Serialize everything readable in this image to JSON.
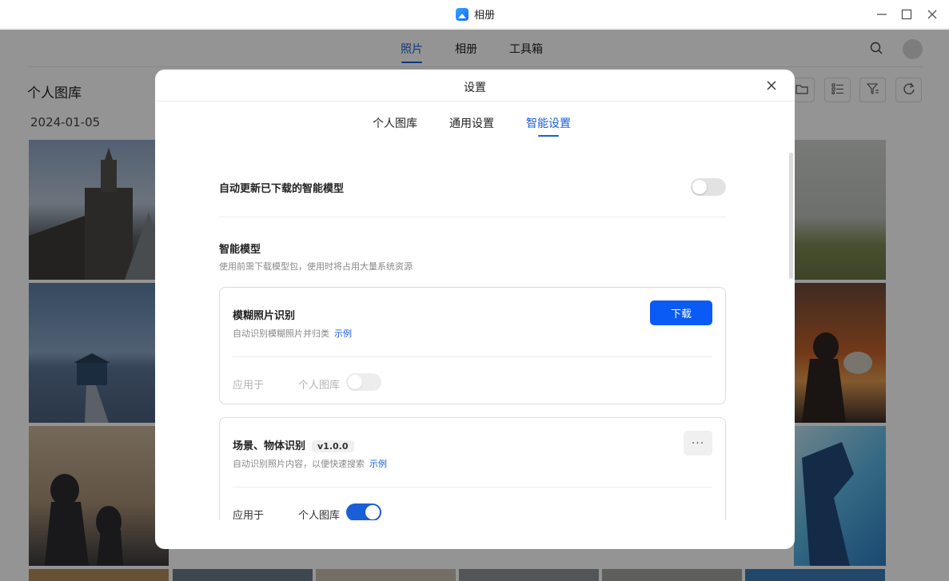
{
  "window": {
    "title": "相册"
  },
  "nav": {
    "tabs": [
      "照片",
      "相册",
      "工具箱"
    ]
  },
  "library": {
    "title": "个人图库",
    "date": "2024-01-05"
  },
  "dialog": {
    "title": "设置",
    "tabs": [
      "个人图库",
      "通用设置",
      "智能设置"
    ],
    "active_tab": "智能设置",
    "auto_update": {
      "label": "自动更新已下载的智能模型",
      "enabled": false
    },
    "models_section": {
      "title": "智能模型",
      "description": "使用前需下载模型包，使用时将占用大量系统资源"
    },
    "cards": [
      {
        "title": "模糊照片识别",
        "description": "自动识别模糊照片并归类",
        "link": "示例",
        "action": "下载",
        "apply_label": "应用于",
        "apply_target": "个人图库",
        "apply_enabled": false
      },
      {
        "title": "场景、物体识别",
        "version": "v1.0.0",
        "description": "自动识别照片内容，以便快速搜索",
        "link": "示例",
        "more": "···",
        "apply_label": "应用于",
        "apply_target": "个人图库",
        "apply_enabled": true
      }
    ]
  },
  "colors": {
    "accent": "#1a5fd8",
    "primary_button": "#0a5af5",
    "overlay": "rgba(0,0,0,0.42)"
  }
}
